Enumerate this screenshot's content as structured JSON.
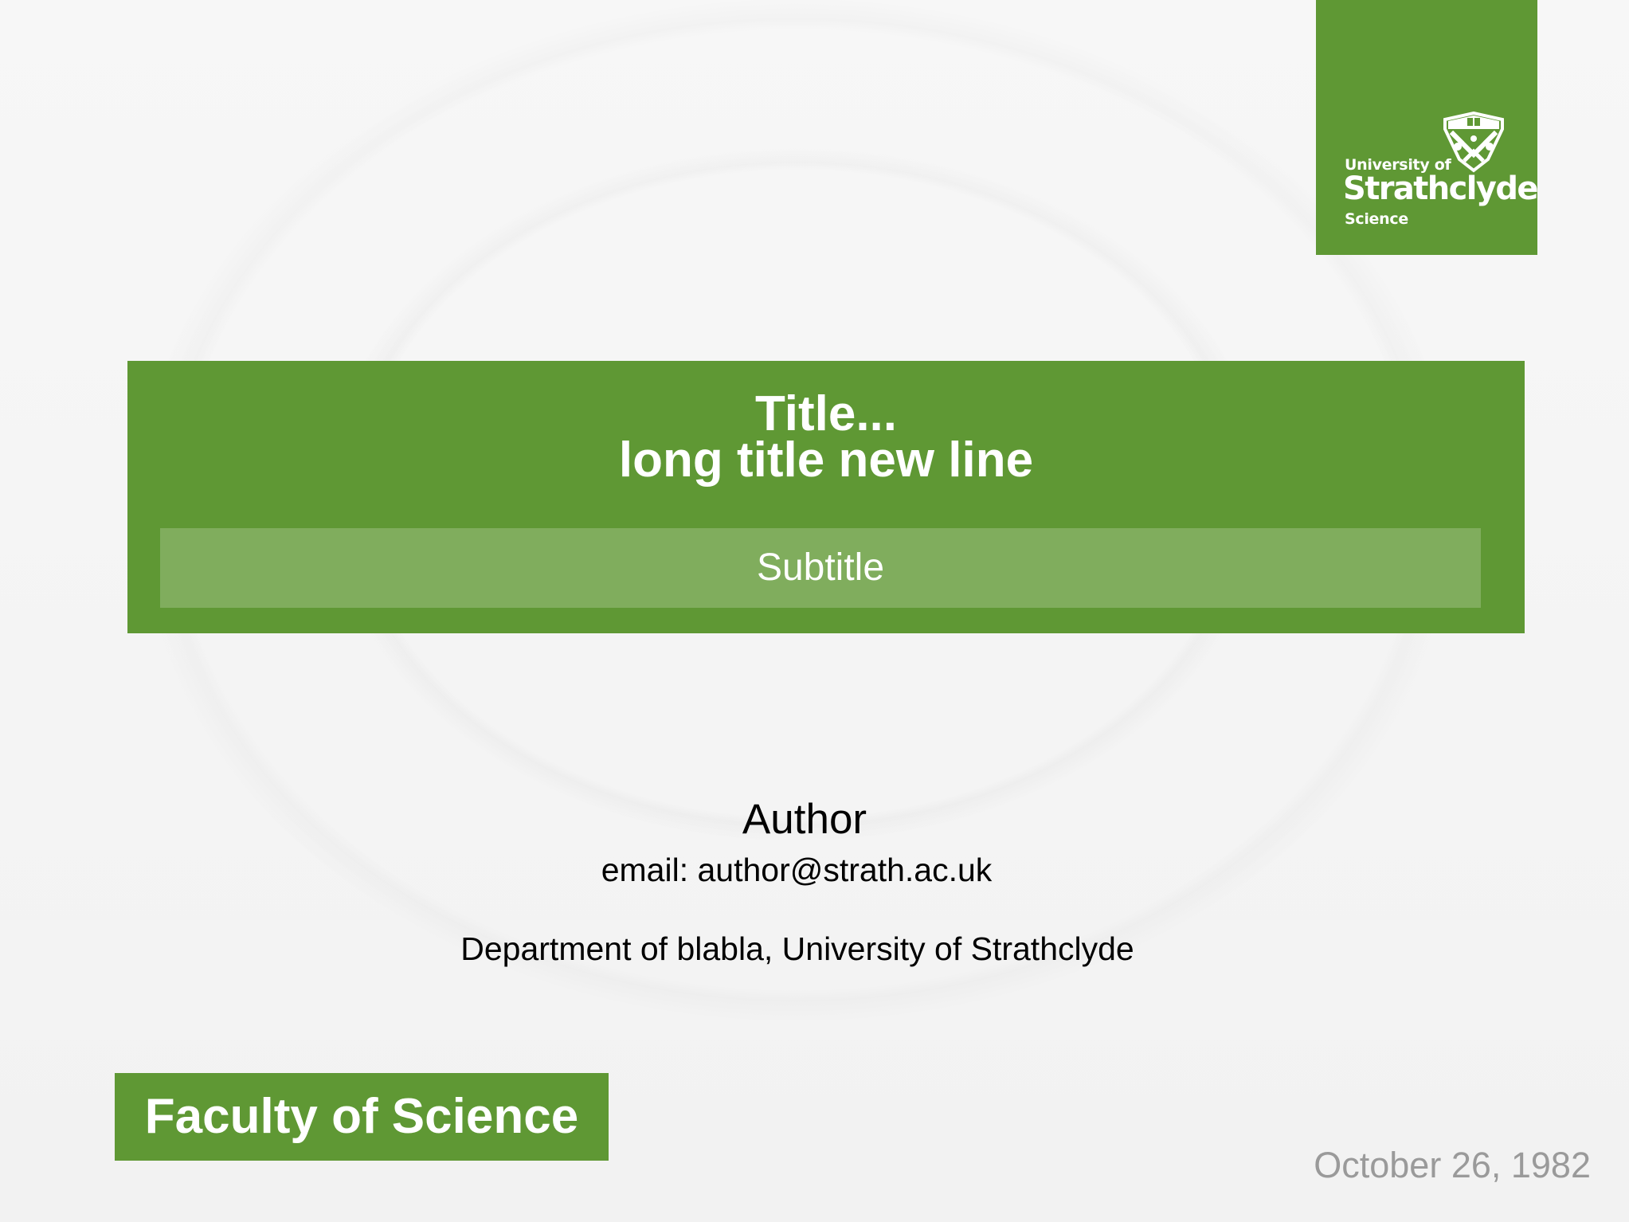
{
  "logo": {
    "line1": "University of",
    "line2": "Strathclyde",
    "line3": "Science",
    "crest_icon": "strathclyde-crest-icon"
  },
  "title": {
    "line1": "Title...",
    "line2": "long title new line"
  },
  "subtitle": "Subtitle",
  "author": {
    "name": "Author",
    "email": "email: author@strath.ac.uk",
    "department": "Department of blabla, University of Strathclyde"
  },
  "faculty": "Faculty of Science",
  "date": "October 26, 1982",
  "colors": {
    "brand_green": "#5f9834",
    "subtitle_green": "#80ad5d",
    "date_gray": "#9a9a9a",
    "background": "#f5f5f5"
  }
}
